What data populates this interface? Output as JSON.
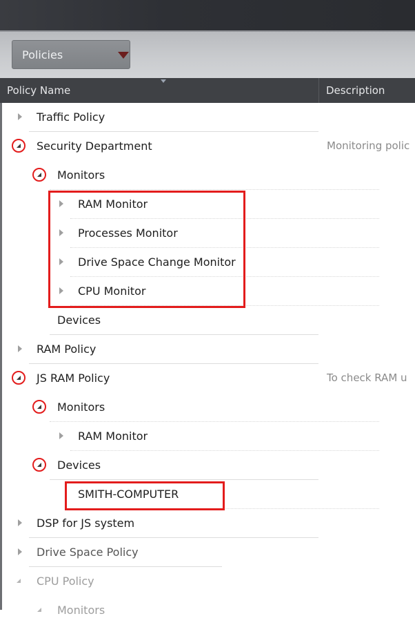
{
  "toolbar": {
    "dropdown_value": "Policies"
  },
  "table": {
    "columns": [
      "Policy Name",
      "Description"
    ]
  },
  "rows": [
    {
      "label": "Traffic Policy",
      "desc": ""
    },
    {
      "label": "Security Department",
      "desc": "Monitoring polic"
    },
    {
      "label": "Monitors",
      "desc": ""
    },
    {
      "label": "RAM  Monitor",
      "desc": ""
    },
    {
      "label": "Processes Monitor",
      "desc": ""
    },
    {
      "label": "Drive Space Change Monitor",
      "desc": ""
    },
    {
      "label": "CPU Monitor",
      "desc": ""
    },
    {
      "label": "Devices",
      "desc": ""
    },
    {
      "label": "RAM Policy",
      "desc": ""
    },
    {
      "label": "JS RAM Policy",
      "desc": "To check RAM u"
    },
    {
      "label": "Monitors",
      "desc": ""
    },
    {
      "label": "RAM  Monitor",
      "desc": ""
    },
    {
      "label": "Devices",
      "desc": ""
    },
    {
      "label": "SMITH-COMPUTER",
      "desc": ""
    },
    {
      "label": "DSP for JS system",
      "desc": ""
    },
    {
      "label": "Drive Space Policy",
      "desc": ""
    },
    {
      "label": "CPU Policy",
      "desc": ""
    },
    {
      "label": "Monitors",
      "desc": ""
    }
  ],
  "colors": {
    "annotation_red": "#e31c1c",
    "header_bg": "#3f4145",
    "titlebar_bg": "#2e3035"
  },
  "icons": {
    "collapsed": "triangle-right-icon",
    "expanded": "triangle-down-icon",
    "dropdown": "caret-down-icon"
  }
}
